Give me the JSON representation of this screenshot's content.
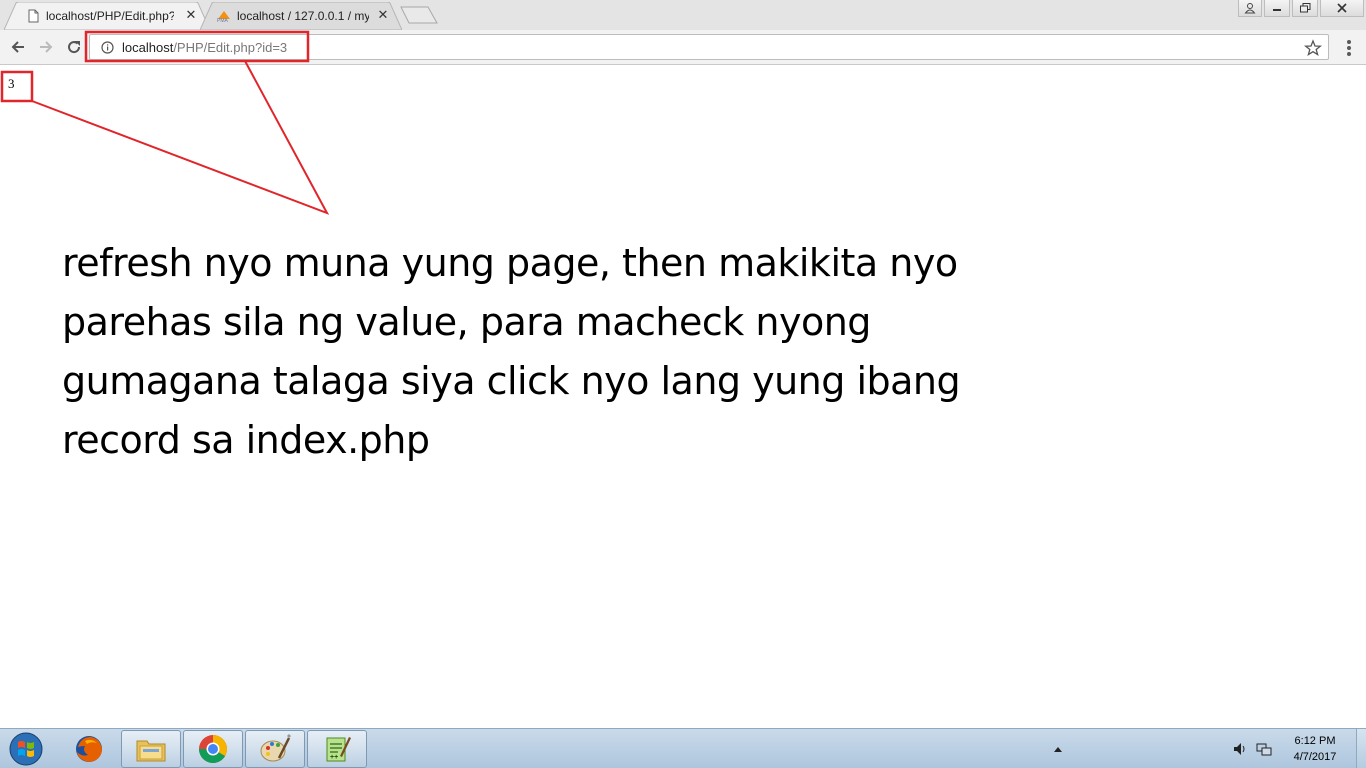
{
  "browser": {
    "tabs": [
      {
        "title": "localhost/PHP/Edit.php?i",
        "favicon": "page-icon",
        "active": true
      },
      {
        "title": "localhost / 127.0.0.1 / my",
        "favicon": "phpmyadmin-icon",
        "active": false
      }
    ],
    "address": {
      "host": "localhost",
      "path": "/PHP/Edit.php?id=3"
    }
  },
  "page": {
    "echo_value": "3",
    "note_lines": [
      "refresh nyo muna yung page, then makikita nyo",
      "parehas sila ng value, para macheck nyong",
      "gumagana talaga siya click nyo lang yung ibang",
      "record sa index.php"
    ]
  },
  "annotation": {
    "color": "#e0252b"
  },
  "taskbar": {
    "apps": [
      "firefox-icon",
      "file-explorer-icon",
      "chrome-icon",
      "paint-icon",
      "notepad-plus-plus-icon"
    ],
    "clock": {
      "time": "6:12 PM",
      "date": "4/7/2017"
    }
  }
}
